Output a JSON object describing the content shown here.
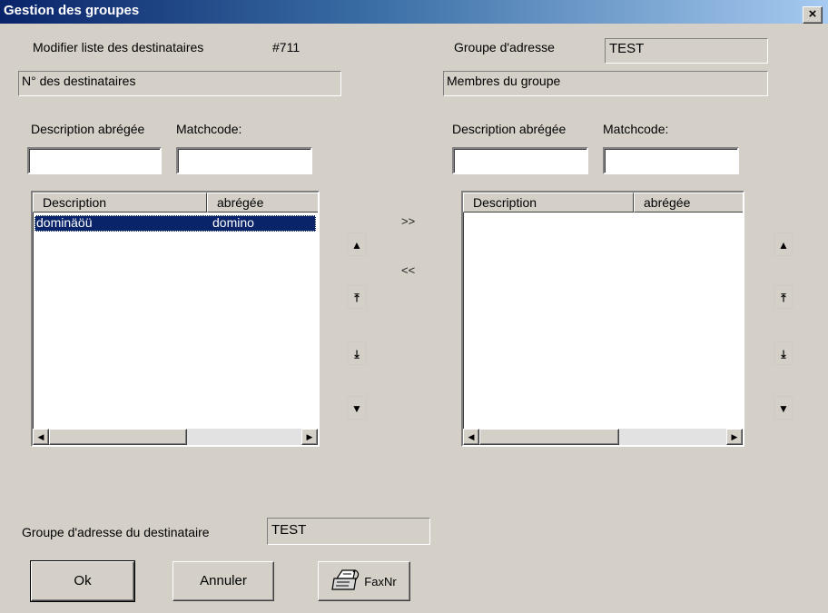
{
  "window": {
    "title": "Gestion des groupes",
    "close_glyph": "×"
  },
  "left": {
    "header_label": "Modifier liste des destinataires",
    "header_number": "#711",
    "section_field": "N° des destinataires",
    "short_desc_label": "Description abrégée",
    "matchcode_label": "Matchcode:",
    "short_desc_value": "",
    "matchcode_value": "",
    "columns": [
      "Description",
      "abrégée"
    ],
    "rows": [
      {
        "description": "dominäöü",
        "short": "domino",
        "selected": true
      }
    ]
  },
  "right": {
    "group_label": "Groupe d'adresse",
    "group_value": "TEST",
    "section_field": "Membres du groupe",
    "short_desc_label": "Description abrégée",
    "matchcode_label": "Matchcode:",
    "short_desc_value": "",
    "matchcode_value": "",
    "columns": [
      "Description",
      "abrégée"
    ],
    "rows": []
  },
  "transfer": {
    "add": ">>",
    "remove": "<<"
  },
  "nav_buttons": {
    "up": "▲",
    "top": "⤒",
    "bottom": "⤓",
    "down": "▼"
  },
  "bottom": {
    "recipient_group_label": "Groupe d'adresse du destinataire",
    "recipient_group_value": "TEST",
    "ok_label": "Ok",
    "cancel_label": "Annuler",
    "fax_label": "FaxNr"
  },
  "icons": {
    "fax": "fax-icon",
    "scroll_left": "scroll-left-icon",
    "scroll_right": "scroll-right-icon"
  },
  "colors": {
    "dialog_bg": "#d4d0c8",
    "title_gradient_start": "#0a246a",
    "title_gradient_end": "#a6caf0",
    "selection": "#0a246a"
  }
}
